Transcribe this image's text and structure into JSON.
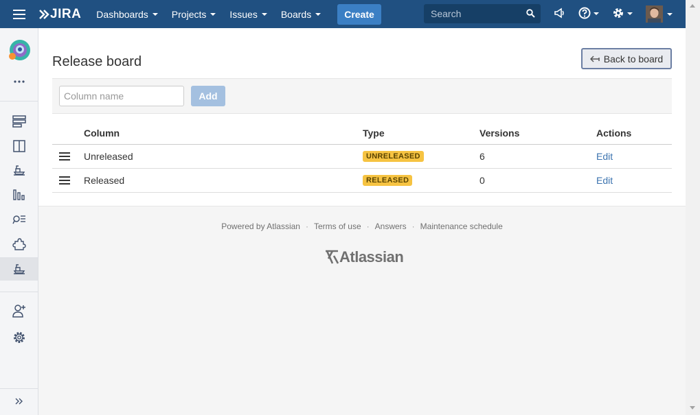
{
  "header": {
    "logo_text": "JIRA",
    "nav": [
      {
        "label": "Dashboards"
      },
      {
        "label": "Projects"
      },
      {
        "label": "Issues"
      },
      {
        "label": "Boards"
      }
    ],
    "create_label": "Create",
    "search_placeholder": "Search",
    "icons": [
      "megaphone-icon",
      "help-icon",
      "gear-icon",
      "avatar"
    ]
  },
  "sidebar": {
    "items": [
      "project-avatar",
      "more-icon",
      "backlog-icon",
      "board-icon",
      "releases-icon",
      "reports-icon",
      "issues-icon",
      "add-ons-icon",
      "release-board-icon",
      "add-people-icon",
      "settings-icon",
      "expand-icon"
    ]
  },
  "page": {
    "title": "Release board",
    "back_label": "Back to board"
  },
  "toolbar": {
    "column_placeholder": "Column name",
    "add_label": "Add"
  },
  "table": {
    "headers": {
      "column": "Column",
      "type": "Type",
      "versions": "Versions",
      "actions": "Actions"
    },
    "rows": [
      {
        "column": "Unreleased",
        "type": "UNRELEASED",
        "versions": "6",
        "action": "Edit"
      },
      {
        "column": "Released",
        "type": "RELEASED",
        "versions": "0",
        "action": "Edit"
      }
    ]
  },
  "footer": {
    "powered": "Powered by Atlassian",
    "terms": "Terms of use",
    "answers": "Answers",
    "maintenance": "Maintenance schedule",
    "separator": "·",
    "logo_text": "Atlassian"
  },
  "colors": {
    "header_bg": "#205081",
    "create_btn": "#3b7fc4",
    "lozenge": "#f6c342",
    "link": "#3b73af"
  }
}
